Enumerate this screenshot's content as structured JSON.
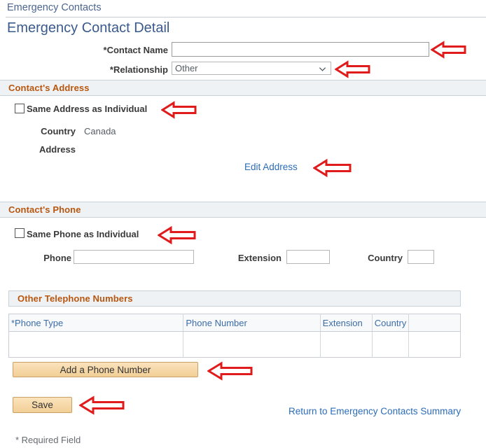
{
  "breadcrumb": {
    "text": "Emergency Contacts"
  },
  "page": {
    "title": "Emergency Contact Detail"
  },
  "form": {
    "contact_name": {
      "label": "*Contact Name",
      "value": "",
      "placeholder": ""
    },
    "relationship": {
      "label": "*Relationship",
      "value": "Other",
      "options": [
        "Other"
      ]
    }
  },
  "address_section": {
    "header": "Contact's Address",
    "same_address_checkbox": {
      "label": "Same Address as Individual",
      "checked": false
    },
    "country": {
      "label": "Country",
      "value": "Canada"
    },
    "address": {
      "label": "Address",
      "value": ""
    },
    "edit_link": "Edit Address"
  },
  "phone_section": {
    "header": "Contact's Phone",
    "same_phone_checkbox": {
      "label": "Same Phone as Individual",
      "checked": false
    },
    "phone": {
      "label": "Phone",
      "value": ""
    },
    "extension": {
      "label": "Extension",
      "value": ""
    },
    "country": {
      "label": "Country",
      "value": ""
    }
  },
  "other_phones": {
    "header": "Other Telephone Numbers",
    "columns": [
      "*Phone Type",
      "Phone Number",
      "Extension",
      "Country",
      ""
    ],
    "rows": [
      {
        "phone_type": "",
        "phone_number": "",
        "extension": "",
        "country": "",
        "spacer": ""
      }
    ],
    "add_button": "Add a Phone Number"
  },
  "actions": {
    "save_button": "Save",
    "return_link": "Return to Emergency Contacts Summary"
  },
  "footer": {
    "required_note": "* Required Field"
  },
  "colors": {
    "section_header_text": "#b8560f",
    "section_header_bg": "#eef2f4",
    "link": "#2b6cb8",
    "title": "#3b5a8c",
    "breadcrumb": "#4a6591",
    "button_face": "#f6d9a9",
    "button_border": "#c9a063",
    "callout_arrow": "#e01b1b",
    "grid_header_text": "#3b6ca8"
  },
  "icons": {
    "chevron_down": "chevron-down-icon",
    "callout_arrow": "arrow-left-callout-icon"
  }
}
